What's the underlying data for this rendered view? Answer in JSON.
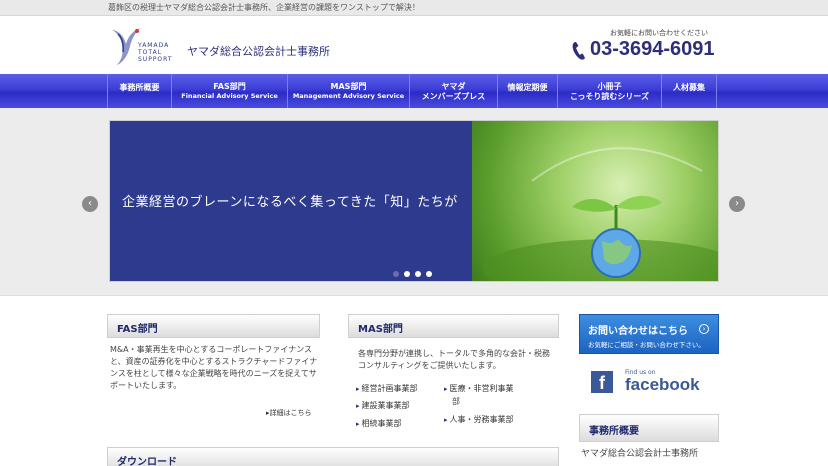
{
  "topbar": {
    "tagline": "葛飾区の税理士ヤマダ総合公認会計士事務所、企業経営の課題をワンストップで解決！"
  },
  "header": {
    "logo_lines": [
      "YAMADA",
      "TOTAL",
      "SUPPORT"
    ],
    "firm_name": "ヤマダ総合公認会計士事務所",
    "contact_note": "お気軽にお問い合わせください",
    "phone": "03-3694-6091",
    "brand_color": "#2d3079"
  },
  "nav": {
    "items": [
      {
        "main": "事務所概要",
        "sub": ""
      },
      {
        "main": "FAS部門",
        "sub": "Financial Advisory Service"
      },
      {
        "main": "MAS部門",
        "sub": "Management Advisory Service"
      },
      {
        "main": "ヤマダ",
        "sub": "メンバーズプレス"
      },
      {
        "main": "情報定期便",
        "sub": ""
      },
      {
        "main": "小冊子",
        "sub": "こっそり読むシリーズ"
      },
      {
        "main": "人材募集",
        "sub": ""
      }
    ]
  },
  "slider": {
    "caption": "企業経営のブレーンになるべく集ってきた「知」たちが",
    "prev_icon": "chevron-left-icon",
    "next_icon": "chevron-right-icon",
    "dot_count": 4,
    "active_dot": 1
  },
  "fas": {
    "title": "FAS部門",
    "body": "M&A・事業再生を中心とするコーポレートファイナンスと、資産の証券化を中心とするストラクチャードファイナンスを柱として様々な企業戦略を時代のニーズを捉えてサポートいたします。",
    "more": "詳細はこちら"
  },
  "mas": {
    "title": "MAS部門",
    "body": "各専門分野が連携し、トータルで多角的な会計・税務コンサルティングをご提供いたします。",
    "left_items": [
      "経営計画事業部",
      "建設業事業部",
      "相続事業部"
    ],
    "right_items": [
      "医療・非営利事業",
      "部",
      "人事・労務事業部"
    ]
  },
  "download": {
    "title": "ダウンロード"
  },
  "contact_button": {
    "label": "お問い合わせはこちら",
    "sub": "お気軽にご相談・お問い合わせ下さい。"
  },
  "facebook": {
    "find": "Find us on",
    "word": "facebook",
    "letter": "f"
  },
  "office": {
    "title": "事務所概要",
    "name": "ヤマダ総合公認会計士事務所"
  }
}
